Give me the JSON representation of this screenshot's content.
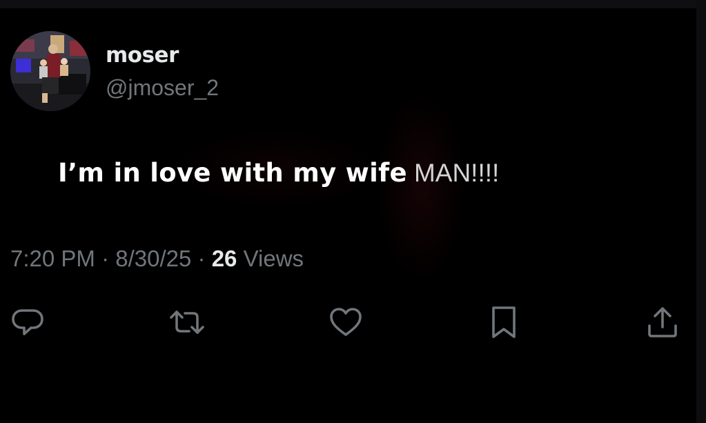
{
  "author": {
    "display_name": "moser",
    "handle": "@jmoser_2"
  },
  "post": {
    "text_main": "I’m in love with my wife",
    "text_suffix": "MAN!!!!"
  },
  "meta": {
    "time": "7:20 PM",
    "separator": "·",
    "date": "8/30/25",
    "views_count": "26",
    "views_label": "Views"
  },
  "actions": [
    {
      "name": "reply",
      "icon": "reply-icon"
    },
    {
      "name": "repost",
      "icon": "repost-icon"
    },
    {
      "name": "like",
      "icon": "heart-icon"
    },
    {
      "name": "bookmark",
      "icon": "bookmark-icon"
    },
    {
      "name": "share",
      "icon": "share-icon"
    }
  ],
  "colors": {
    "background": "#000000",
    "primary_text": "#e7e9ea",
    "secondary_text": "#71767b"
  }
}
